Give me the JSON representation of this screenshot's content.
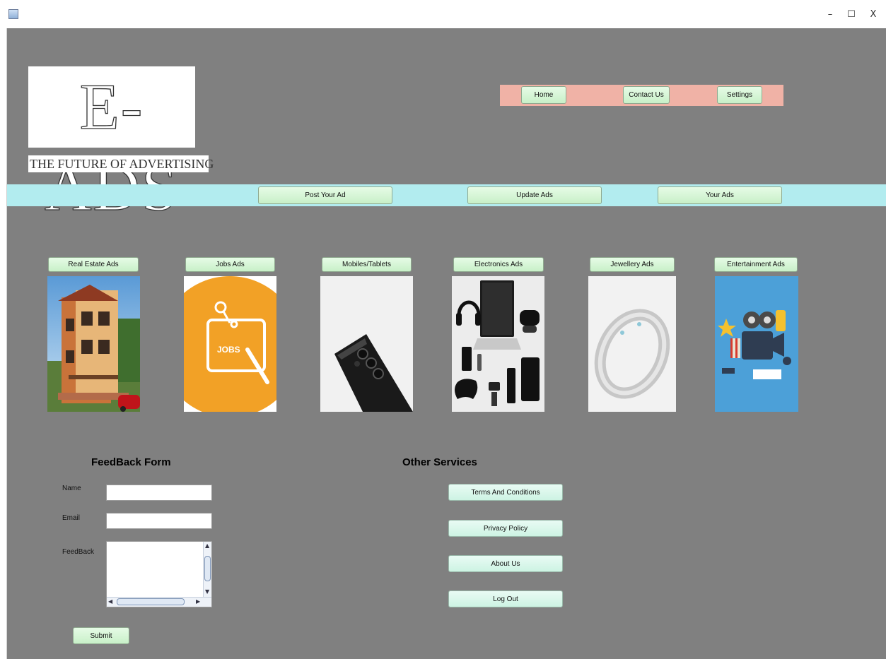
{
  "window": {
    "minimize_glyph": "–",
    "maximize_glyph": "☐",
    "close_glyph": "X"
  },
  "logo": {
    "title": "E-ADS",
    "tagline": "THE FUTURE OF ADVERTISING"
  },
  "topnav": {
    "home": "Home",
    "contact": "Contact Us",
    "settings": "Settings"
  },
  "actions": {
    "post": "Post Your Ad",
    "update": "Update Ads",
    "yours": "Your Ads"
  },
  "categories": [
    {
      "label": "Real Estate Ads",
      "icon": "house-image"
    },
    {
      "label": "Jobs Ads",
      "icon": "jobs-image",
      "image_text": "JOBS"
    },
    {
      "label": "Mobiles/Tablets",
      "icon": "phone-image"
    },
    {
      "label": "Electronics Ads",
      "icon": "electronics-image"
    },
    {
      "label": "Jewellery Ads",
      "icon": "ring-image"
    },
    {
      "label": "Entertainment Ads",
      "icon": "entertainment-image"
    }
  ],
  "feedback": {
    "heading": "FeedBack Form",
    "name_label": "Name",
    "email_label": "Email",
    "feedback_label": "FeedBack",
    "name_value": "",
    "email_value": "",
    "feedback_value": "",
    "submit": "Submit"
  },
  "services": {
    "heading": "Other Services",
    "terms": "Terms And Conditions",
    "privacy": "Privacy Policy",
    "about": "About Us",
    "logout": "Log Out"
  },
  "colors": {
    "background": "#808080",
    "topnav_bg": "#f0b2a6",
    "action_strip_bg": "#b2ecef",
    "button_bg": "#d4f5d4",
    "service_button_bg": "#d7f7ea"
  }
}
